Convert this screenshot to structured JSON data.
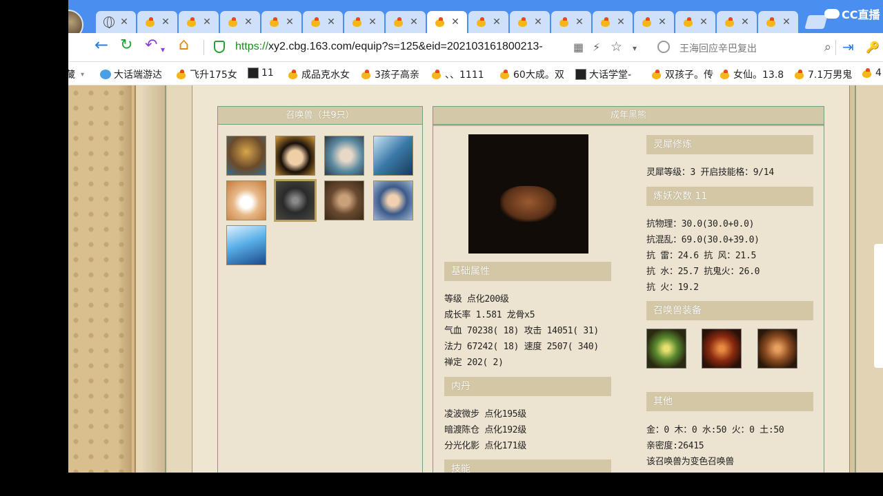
{
  "browser": {
    "tabs_chick_count": 16,
    "tab_close": "✕",
    "cc_label": "CC直播",
    "url_prefix": "https://",
    "url_rest": "xy2.cbg.163.com/equip?s=125&eid=202103161800213-",
    "search_placeholder": "王海回应辛巴复出",
    "icons": {
      "back": "←",
      "reload": "↻",
      "undo": "↶",
      "home": "⌂",
      "qr": "▦",
      "lightning": "⚡",
      "star": "☆",
      "dropdown": "▾",
      "login": "⇥",
      "key": "🔑"
    }
  },
  "bookmarks": [
    {
      "label": "藏",
      "icon": "none"
    },
    {
      "label": "大话端游达",
      "icon": "blue"
    },
    {
      "label": "飞升175女",
      "icon": "chick"
    },
    {
      "label": "11",
      "icon": "square"
    },
    {
      "label": "成品克水女",
      "icon": "chick"
    },
    {
      "label": "3孩子高亲",
      "icon": "chick"
    },
    {
      "label": "、、1111",
      "icon": "chick"
    },
    {
      "label": "60大成。双",
      "icon": "chick"
    },
    {
      "label": "大话学堂-",
      "icon": "square"
    },
    {
      "label": "双孩子。传",
      "icon": "chick"
    },
    {
      "label": "女仙。13.8",
      "icon": "chick"
    },
    {
      "label": "7.1万男鬼",
      "icon": "chick"
    },
    {
      "label": "4",
      "icon": "chick"
    }
  ],
  "summon_panel": {
    "title": "召唤兽（共9只）"
  },
  "detail_panel": {
    "title": "成年黑熊",
    "basic": {
      "head": "基础属性",
      "lines": [
        "等级 点化200级",
        "成长率 1.581 龙骨x5",
        "气血 70238( 18) 攻击 14051( 31)",
        "法力 67242( 18) 速度 2507( 340)",
        "禅定 202( 2)"
      ]
    },
    "neidan": {
      "head": "内丹",
      "lines": [
        "凌波微步 点化195级",
        "暗渡陈仓 点化192级",
        "分光化影 点化171级"
      ]
    },
    "skills_head": "技能",
    "lingxi": {
      "head": "灵犀修炼",
      "line": "灵犀等级：3   开启技能格：9/14"
    },
    "lianyao": {
      "head": "炼妖次数 11",
      "lines": [
        "抗物理：30.0(30.0+0.0)",
        "抗混乱：69.0(30.0+39.0)",
        "抗  雷：24.6 抗  风：21.5",
        "抗  水：25.7 抗鬼火：26.0",
        "抗  火：19.2"
      ]
    },
    "equip_head": "召唤兽装备",
    "other": {
      "head": "其他",
      "lines": [
        "金：0 木：0 水:50 火：0 土:50",
        "亲密度:26415",
        "该召唤兽为变色召唤兽"
      ]
    }
  }
}
